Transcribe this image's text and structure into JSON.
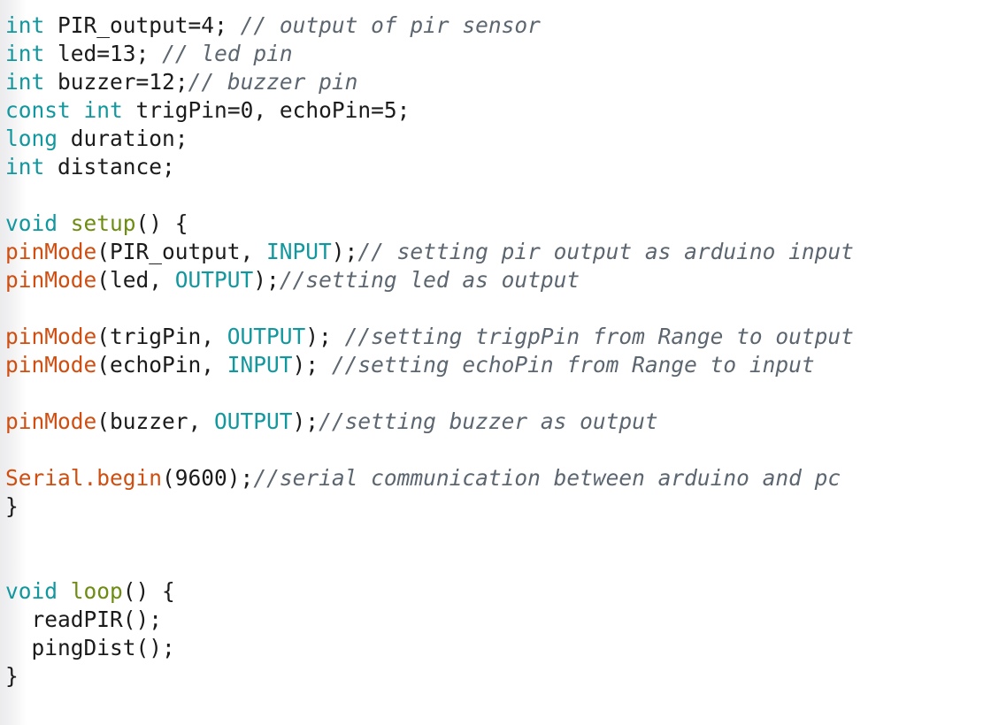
{
  "editor": {
    "title": "Arduino sketch source listing",
    "language": "C++ (Arduino)",
    "background_color": "#ffffff",
    "font_size_px": 24.5,
    "line_height_px": 32,
    "palette": {
      "keyword": "#11989f",
      "constant": "#11989f",
      "function_definition": "#6d8c12",
      "builtin_function": "#cf4e10",
      "comment": "#5c6670",
      "plain_text": "#1b1b1b",
      "left_edge_shadow": "#ececed"
    }
  },
  "lines": [
    {
      "n": 1,
      "tokens": [
        {
          "t": "int",
          "c": "keyword"
        },
        {
          "t": " PIR_output",
          "c": "plain"
        },
        {
          "t": "=",
          "c": "punct"
        },
        {
          "t": "4",
          "c": "number"
        },
        {
          "t": "; ",
          "c": "punct"
        },
        {
          "t": "// output of pir sensor",
          "c": "comment"
        }
      ]
    },
    {
      "n": 2,
      "tokens": [
        {
          "t": "int",
          "c": "keyword"
        },
        {
          "t": " led",
          "c": "plain"
        },
        {
          "t": "=",
          "c": "punct"
        },
        {
          "t": "13",
          "c": "number"
        },
        {
          "t": "; ",
          "c": "punct"
        },
        {
          "t": "// led pin",
          "c": "comment"
        }
      ]
    },
    {
      "n": 3,
      "tokens": [
        {
          "t": "int",
          "c": "keyword"
        },
        {
          "t": " buzzer",
          "c": "plain"
        },
        {
          "t": "=",
          "c": "punct"
        },
        {
          "t": "12",
          "c": "number"
        },
        {
          "t": ";",
          "c": "punct"
        },
        {
          "t": "// buzzer pin",
          "c": "comment"
        }
      ]
    },
    {
      "n": 4,
      "tokens": [
        {
          "t": "const",
          "c": "keyword"
        },
        {
          "t": " ",
          "c": "plain"
        },
        {
          "t": "int",
          "c": "keyword"
        },
        {
          "t": " trigPin",
          "c": "plain"
        },
        {
          "t": "=",
          "c": "punct"
        },
        {
          "t": "0",
          "c": "number"
        },
        {
          "t": ", echoPin",
          "c": "plain"
        },
        {
          "t": "=",
          "c": "punct"
        },
        {
          "t": "5",
          "c": "number"
        },
        {
          "t": ";",
          "c": "punct"
        }
      ]
    },
    {
      "n": 5,
      "tokens": [
        {
          "t": "long",
          "c": "keyword"
        },
        {
          "t": " duration;",
          "c": "plain"
        }
      ]
    },
    {
      "n": 6,
      "tokens": [
        {
          "t": "int",
          "c": "keyword"
        },
        {
          "t": " distance;",
          "c": "plain"
        }
      ]
    },
    {
      "n": 7,
      "tokens": []
    },
    {
      "n": 8,
      "tokens": [
        {
          "t": "void",
          "c": "keyword"
        },
        {
          "t": " ",
          "c": "plain"
        },
        {
          "t": "setup",
          "c": "funcdef"
        },
        {
          "t": "() {",
          "c": "punct"
        }
      ]
    },
    {
      "n": 9,
      "tokens": [
        {
          "t": "pinMode",
          "c": "builtin"
        },
        {
          "t": "(PIR_output, ",
          "c": "plain"
        },
        {
          "t": "INPUT",
          "c": "constant"
        },
        {
          "t": ");",
          "c": "punct"
        },
        {
          "t": "// setting pir output as arduino input",
          "c": "comment"
        }
      ]
    },
    {
      "n": 10,
      "tokens": [
        {
          "t": "pinMode",
          "c": "builtin"
        },
        {
          "t": "(led, ",
          "c": "plain"
        },
        {
          "t": "OUTPUT",
          "c": "constant"
        },
        {
          "t": ");",
          "c": "punct"
        },
        {
          "t": "//setting led as output",
          "c": "comment"
        }
      ]
    },
    {
      "n": 11,
      "tokens": []
    },
    {
      "n": 12,
      "tokens": [
        {
          "t": "pinMode",
          "c": "builtin"
        },
        {
          "t": "(trigPin, ",
          "c": "plain"
        },
        {
          "t": "OUTPUT",
          "c": "constant"
        },
        {
          "t": "); ",
          "c": "punct"
        },
        {
          "t": "//setting trigpPin from Range to output",
          "c": "comment"
        }
      ]
    },
    {
      "n": 13,
      "tokens": [
        {
          "t": "pinMode",
          "c": "builtin"
        },
        {
          "t": "(echoPin, ",
          "c": "plain"
        },
        {
          "t": "INPUT",
          "c": "constant"
        },
        {
          "t": "); ",
          "c": "punct"
        },
        {
          "t": "//setting echoPin from Range to input",
          "c": "comment"
        }
      ]
    },
    {
      "n": 14,
      "tokens": []
    },
    {
      "n": 15,
      "tokens": [
        {
          "t": "pinMode",
          "c": "builtin"
        },
        {
          "t": "(buzzer, ",
          "c": "plain"
        },
        {
          "t": "OUTPUT",
          "c": "constant"
        },
        {
          "t": ");",
          "c": "punct"
        },
        {
          "t": "//setting buzzer as output",
          "c": "comment"
        }
      ]
    },
    {
      "n": 16,
      "tokens": []
    },
    {
      "n": 17,
      "tokens": [
        {
          "t": "Serial.begin",
          "c": "builtin"
        },
        {
          "t": "(",
          "c": "punct"
        },
        {
          "t": "9600",
          "c": "number"
        },
        {
          "t": ");",
          "c": "punct"
        },
        {
          "t": "//serial communication between arduino and pc",
          "c": "comment"
        }
      ]
    },
    {
      "n": 18,
      "tokens": [
        {
          "t": "}",
          "c": "punct"
        }
      ]
    },
    {
      "n": 19,
      "tokens": []
    },
    {
      "n": 20,
      "tokens": []
    },
    {
      "n": 21,
      "tokens": [
        {
          "t": "void",
          "c": "keyword"
        },
        {
          "t": " ",
          "c": "plain"
        },
        {
          "t": "loop",
          "c": "funcdef"
        },
        {
          "t": "() {",
          "c": "punct"
        }
      ]
    },
    {
      "n": 22,
      "tokens": [
        {
          "t": "  readPIR();",
          "c": "plain"
        }
      ]
    },
    {
      "n": 23,
      "tokens": [
        {
          "t": "  pingDist();",
          "c": "plain"
        }
      ]
    },
    {
      "n": 24,
      "tokens": [
        {
          "t": "}",
          "c": "punct"
        }
      ]
    }
  ]
}
